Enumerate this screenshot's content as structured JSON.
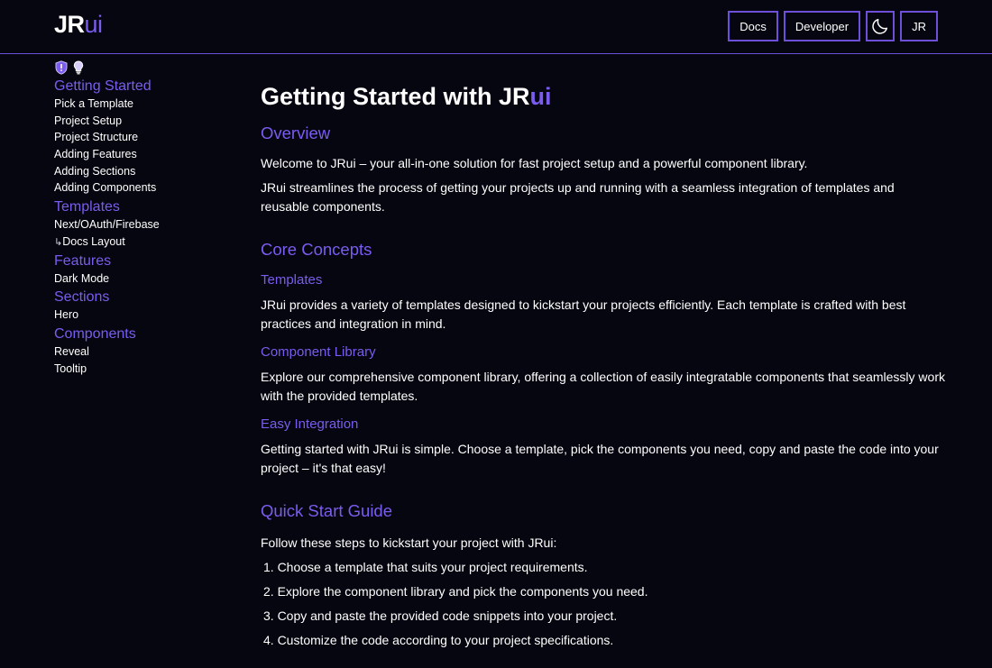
{
  "header": {
    "logo_part1": "JR",
    "logo_part2": "ui",
    "nav": {
      "docs": "Docs",
      "developer": "Developer",
      "theme_icon": "moon-icon",
      "avatar": "JR"
    }
  },
  "sidebar": {
    "icons": [
      "shield-alert-icon",
      "lightbulb-icon"
    ],
    "sections": [
      {
        "heading": "Getting Started",
        "items": [
          "Pick a Template",
          "Project Setup",
          "Project Structure",
          "Adding Features",
          "Adding Sections",
          "Adding Components"
        ]
      },
      {
        "heading": "Templates",
        "items": [
          "Next/OAuth/Firebase",
          "Docs Layout"
        ]
      },
      {
        "heading": "Features",
        "items": [
          "Dark Mode"
        ]
      },
      {
        "heading": "Sections",
        "items": [
          "Hero"
        ]
      },
      {
        "heading": "Components",
        "items": [
          "Reveal",
          "Tooltip"
        ]
      }
    ],
    "sub_arrow": "↳"
  },
  "main": {
    "title_prefix": "Getting Started with ",
    "title_jr": "JR",
    "title_ui": "ui",
    "overview": {
      "heading": "Overview",
      "p1": "Welcome to JRui – your all-in-one solution for fast project setup and a powerful component library.",
      "p2": "JRui streamlines the process of getting your projects up and running with a seamless integration of templates and reusable components."
    },
    "core": {
      "heading": "Core Concepts",
      "templates_heading": "Templates",
      "templates_text": "JRui provides a variety of templates designed to kickstart your projects efficiently. Each template is crafted with best practices and integration in mind.",
      "library_heading": "Component Library",
      "library_text": "Explore our comprehensive component library, offering a collection of easily integratable components that seamlessly work with the provided templates.",
      "integration_heading": "Easy Integration",
      "integration_text": "Getting started with JRui is simple. Choose a template, pick the components you need, copy and paste the code into your project – it's that easy!"
    },
    "quick": {
      "heading": "Quick Start Guide",
      "intro": "Follow these steps to kickstart your project with JRui:",
      "steps": [
        "1. Choose a template that suits your project requirements.",
        "2. Explore the component library and pick the components you need.",
        "3. Copy and paste the provided code snippets into your project.",
        "4. Customize the code according to your project specifications."
      ]
    }
  },
  "colors": {
    "background": "#05060f",
    "accent": "#7b5cf0",
    "border": "#6d4fd8"
  }
}
